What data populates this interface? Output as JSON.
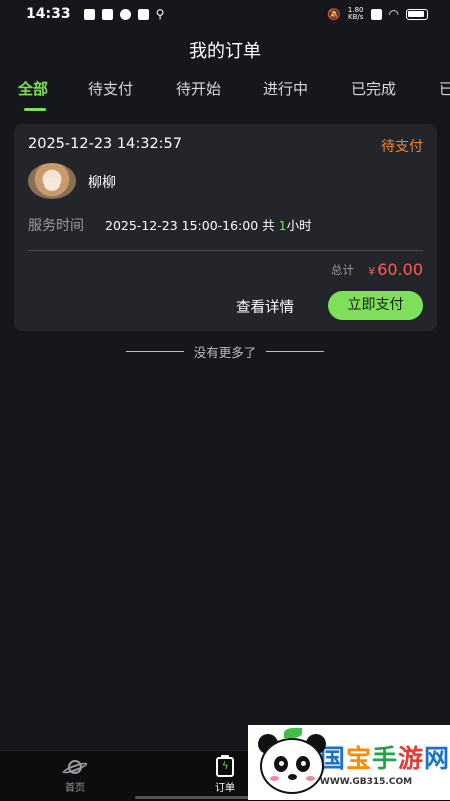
{
  "status_bar": {
    "time": "14:33",
    "speed": "1.80",
    "speed_unit": "KB/s"
  },
  "header": {
    "title": "我的订单"
  },
  "tabs": [
    {
      "label": "全部",
      "active": true
    },
    {
      "label": "待支付",
      "active": false
    },
    {
      "label": "待开始",
      "active": false
    },
    {
      "label": "进行中",
      "active": false
    },
    {
      "label": "已完成",
      "active": false
    },
    {
      "label": "已",
      "active": false
    }
  ],
  "order": {
    "created_at": "2025-12-23 14:32:57",
    "status": "待支付",
    "provider_name": "柳柳",
    "service_time_label": "服务时间",
    "service_time_range": "2025-12-23 15:00-16:00",
    "duration_prefix": " 共 ",
    "duration_value": "1",
    "duration_unit": "小时",
    "total_label": "总计",
    "currency_symbol": "¥",
    "total_amount": "60.00",
    "detail_button": "查看详情",
    "pay_button": "立即支付"
  },
  "list_end_text": "没有更多了",
  "bottom_nav": {
    "items": [
      {
        "label": "首页",
        "icon": "planet-icon",
        "active": false
      },
      {
        "label": "订单",
        "icon": "order-clipboard-icon",
        "active": true
      }
    ]
  },
  "watermark": {
    "brand": "国宝手游网",
    "url": "WWW.GB315.COM"
  },
  "colors": {
    "accent": "#7ee05a",
    "pending": "#f0883a",
    "price": "#ff5a5a",
    "background": "#16171b",
    "card": "#24252a"
  }
}
